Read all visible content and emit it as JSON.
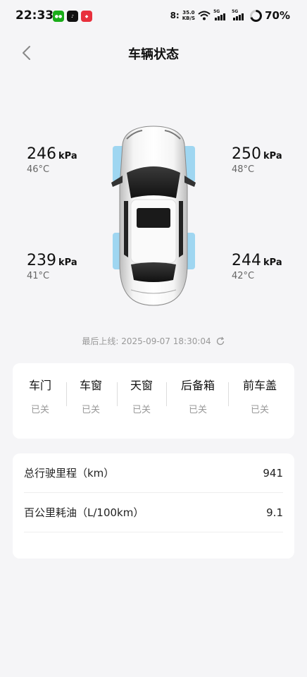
{
  "status_bar": {
    "time": "22:33",
    "net_speed_value": "35.0",
    "net_speed_unit": "KB/S",
    "signal_1_tag": "5G",
    "signal_2_tag": "5G",
    "battery": "70%",
    "battery_level": 0.7
  },
  "header": {
    "title": "车辆状态",
    "back_icon": "chevron-left-icon"
  },
  "tires": {
    "front_left": {
      "pressure": "246",
      "unit": "kPa",
      "temp": "46°C"
    },
    "front_right": {
      "pressure": "250",
      "unit": "kPa",
      "temp": "48°C"
    },
    "rear_left": {
      "pressure": "239",
      "unit": "kPa",
      "temp": "41°C"
    },
    "rear_right": {
      "pressure": "244",
      "unit": "kPa",
      "temp": "42°C"
    }
  },
  "last_online": {
    "label": "最后上线: 2025-09-07 18:30:04",
    "icon": "refresh-icon"
  },
  "status_items": [
    {
      "name": "车门",
      "value": "已关"
    },
    {
      "name": "车窗",
      "value": "已关"
    },
    {
      "name": "天窗",
      "value": "已关"
    },
    {
      "name": "后备箱",
      "value": "已关"
    },
    {
      "name": "前车盖",
      "value": "已关"
    }
  ],
  "info": [
    {
      "label": "总行驶里程（km）",
      "value": "941"
    },
    {
      "label": "百公里耗油（L/100km）",
      "value": "9.1"
    }
  ],
  "colors": {
    "background": "#f5f5f7",
    "card": "#ffffff",
    "tire_highlight": "#8fd0f0",
    "muted_text": "#999999"
  }
}
